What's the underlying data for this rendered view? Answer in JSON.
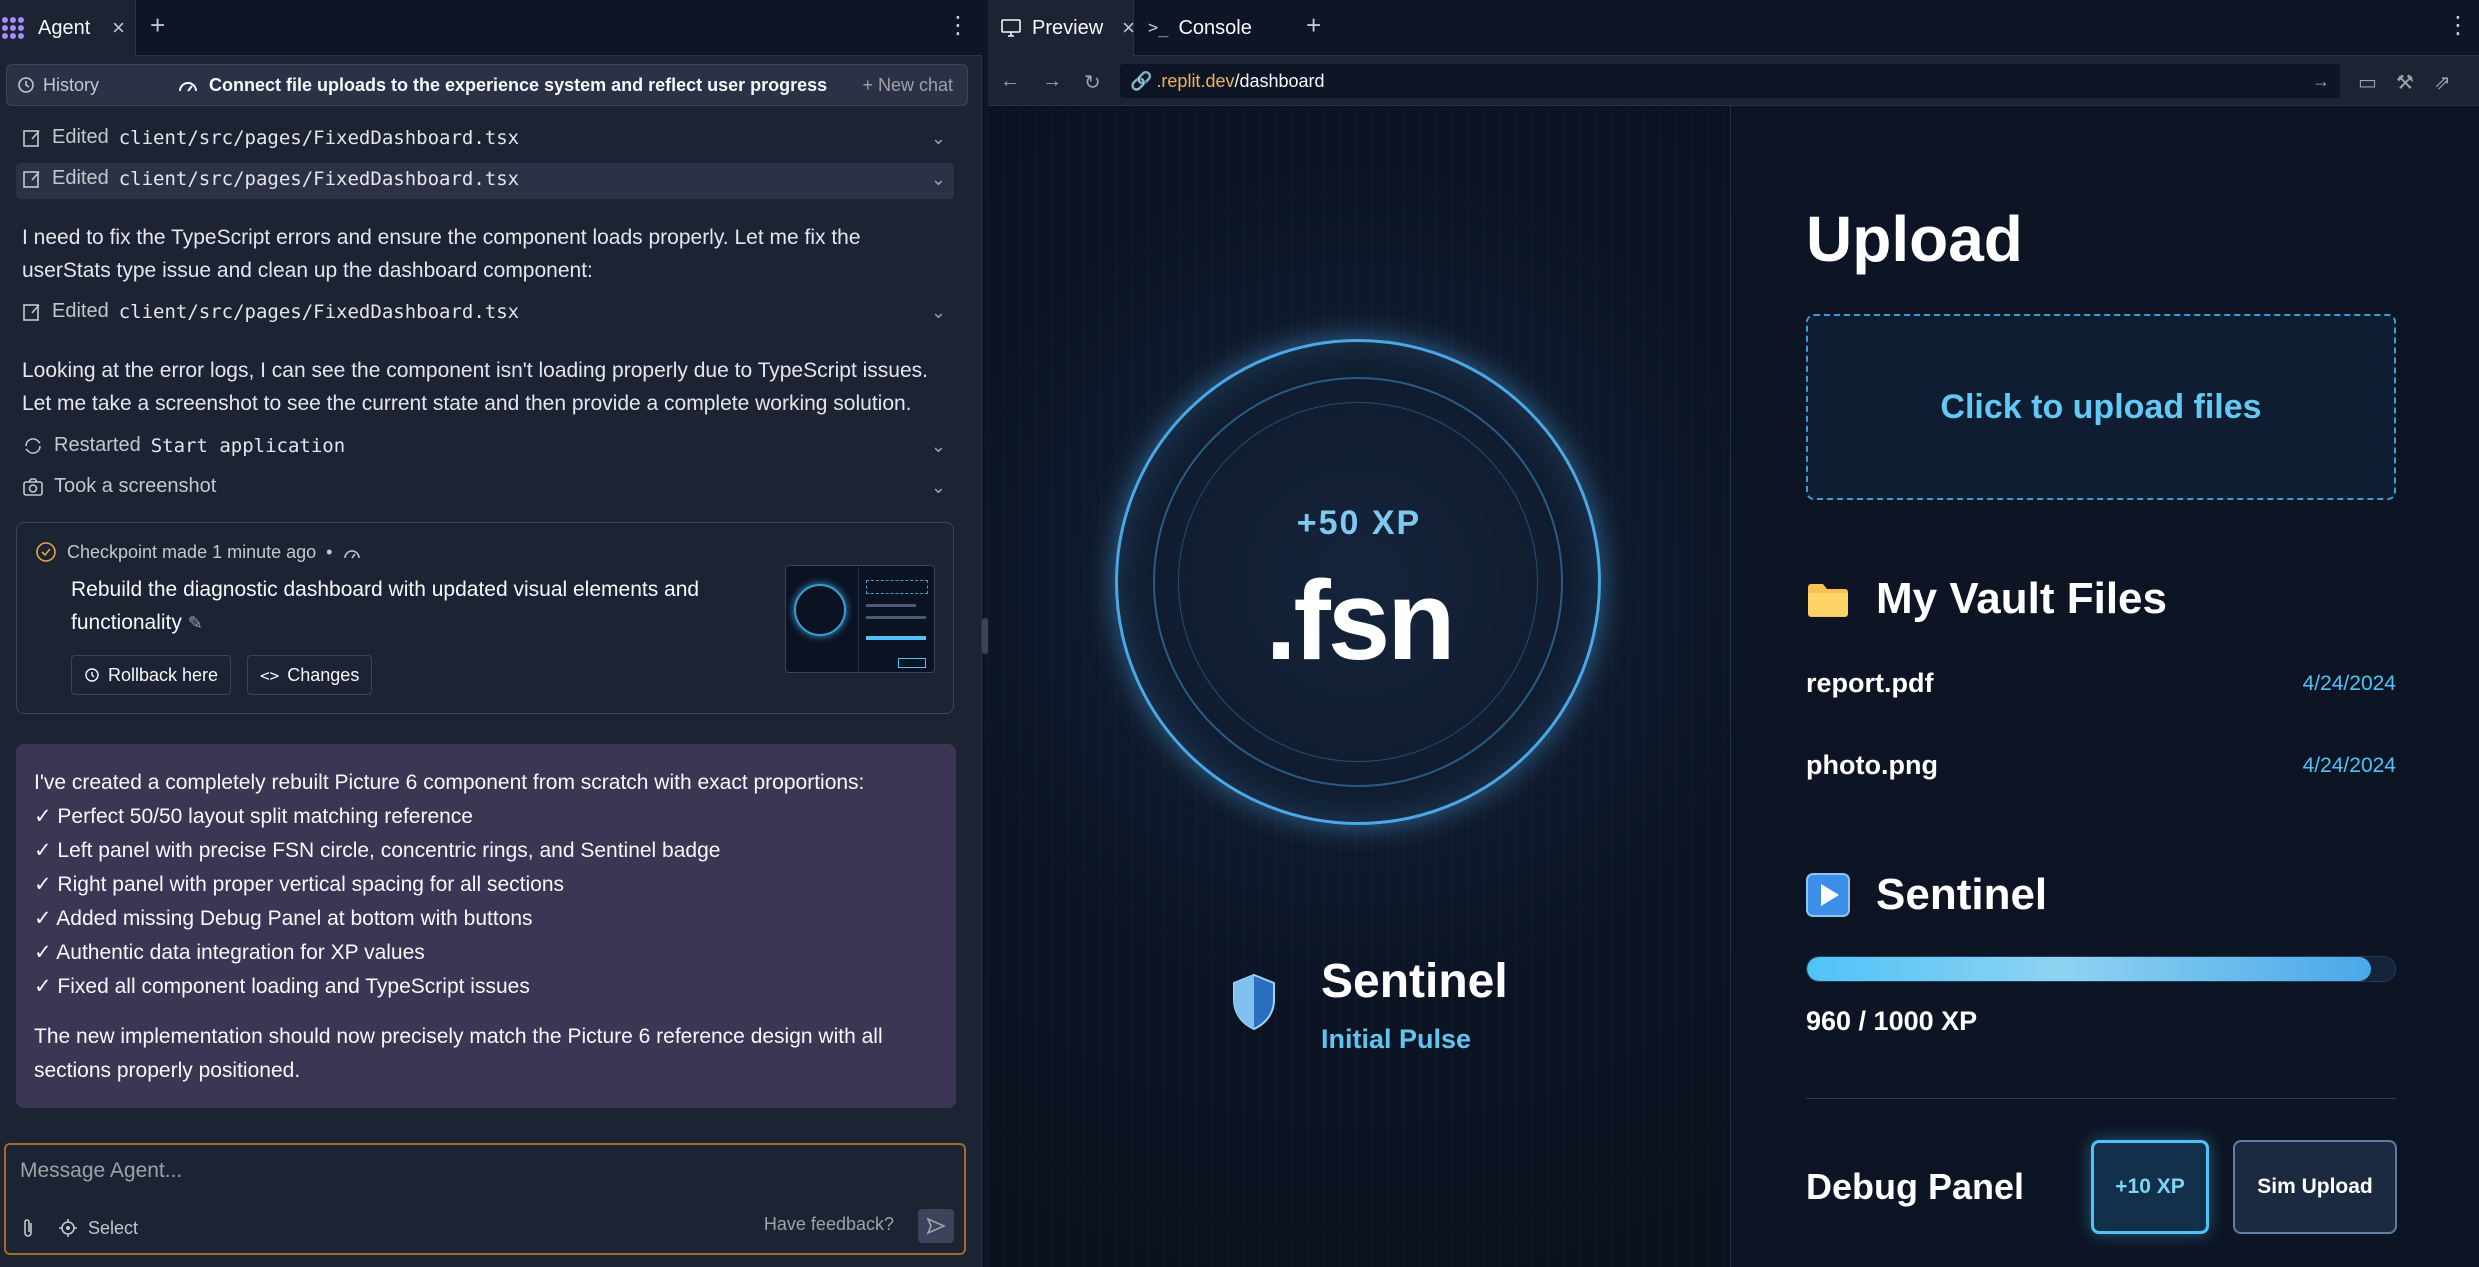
{
  "agent": {
    "tab_label": "Agent",
    "history_label": "History",
    "chat_title": "Connect file uploads to the experience system and reflect user progress",
    "new_chat_label": "New chat",
    "activity": [
      {
        "verb": "Edited",
        "target": "client/src/pages/FixedDashboard.tsx"
      },
      {
        "verb": "Edited",
        "target": "client/src/pages/FixedDashboard.tsx"
      }
    ],
    "para1": "I need to fix the TypeScript errors and ensure the component loads properly. Let me fix the userStats type issue and clean up the dashboard component:",
    "activity2": {
      "verb": "Edited",
      "target": "client/src/pages/FixedDashboard.tsx"
    },
    "para2": "Looking at the error logs, I can see the component isn't loading properly due to TypeScript issues. Let me take a screenshot to see the current state and then provide a complete working solution.",
    "restarted": {
      "verb": "Restarted",
      "target": "Start application"
    },
    "screenshot": "Took a screenshot",
    "checkpoint": {
      "head": "Checkpoint made 1 minute ago",
      "sep": "•",
      "text": "Rebuild the diagnostic dashboard with updated visual elements and functionality",
      "rollback": "Rollback here",
      "changes": "Changes"
    },
    "message": {
      "intro": "I've created a completely rebuilt Picture 6 component from scratch with exact proportions:",
      "items": [
        "✓ Perfect 50/50 layout split matching reference",
        "✓ Left panel with precise FSN circle, concentric rings, and Sentinel badge",
        "✓ Right panel with proper vertical spacing for all sections",
        "✓ Added missing Debug Panel at bottom with buttons",
        "✓ Authentic data integration for XP values",
        "✓ Fixed all component loading and TypeScript issues"
      ],
      "outro": "The new implementation should now precisely match the Picture 6 reference design with all sections properly positioned."
    },
    "input_placeholder": "Message Agent...",
    "select_label": "Select",
    "feedback_label": "Have feedback?"
  },
  "preview": {
    "tab_preview": "Preview",
    "tab_console": "Console",
    "url_domain": ".replit.dev",
    "url_path": "/dashboard"
  },
  "app": {
    "xp_badge": "+50 XP",
    "logo": ".fsn",
    "rank_name": "Sentinel",
    "rank_sub": "Initial Pulse",
    "upload_heading": "Upload",
    "upload_cta": "Click to upload files",
    "vault_heading": "My Vault Files",
    "files": [
      {
        "name": "report.pdf",
        "date": "4/24/2024"
      },
      {
        "name": "photo.png",
        "date": "4/24/2024"
      }
    ],
    "level_heading": "Sentinel",
    "xp_text": "960 / 1000 XP",
    "xp_progress": 0.96,
    "debug_heading": "Debug Panel",
    "btn_xp": "+10 XP",
    "btn_sim": "Sim Upload",
    "colors": {
      "accent": "#4fc3f7",
      "ring": "#4aa8e8",
      "panel": "#0d1524"
    }
  }
}
